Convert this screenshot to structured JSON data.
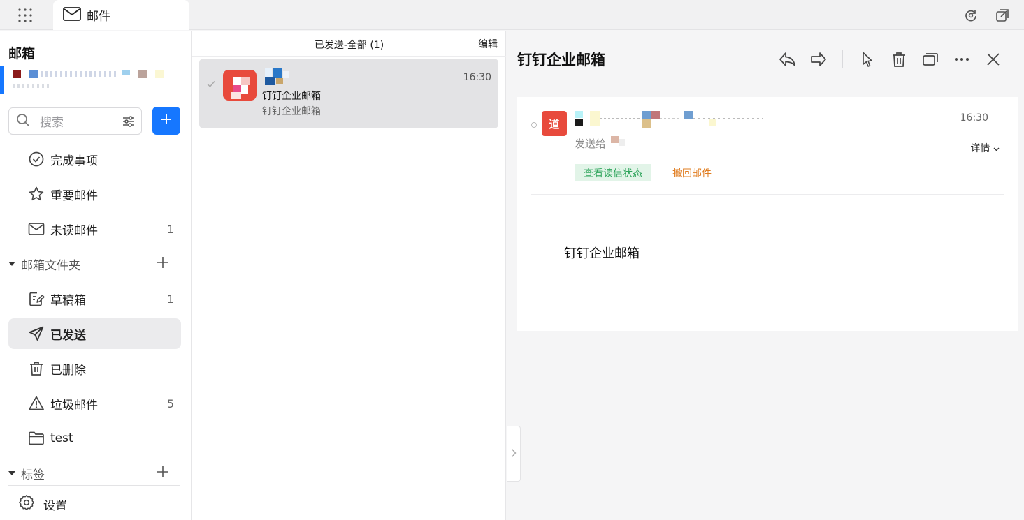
{
  "topbar": {
    "tab_label": "邮件",
    "tab_icon": "mail-icon",
    "right_icons": [
      "refresh-icon",
      "popout-window-icon"
    ]
  },
  "sidebar": {
    "title": "邮箱",
    "search_placeholder": "搜索",
    "quick_items": [
      {
        "label": "完成事项",
        "icon": "check-circle-icon",
        "count": ""
      },
      {
        "label": "重要邮件",
        "icon": "star-icon",
        "count": ""
      },
      {
        "label": "未读邮件",
        "icon": "mail-icon",
        "count": "1"
      }
    ],
    "folders_section": "邮箱文件夹",
    "folders": [
      {
        "label": "草稿箱",
        "icon": "draft-icon",
        "count": "1"
      },
      {
        "label": "已发送",
        "icon": "send-icon",
        "count": "",
        "active": true
      },
      {
        "label": "已删除",
        "icon": "trash-icon",
        "count": ""
      },
      {
        "label": "垃圾邮件",
        "icon": "warning-icon",
        "count": "5"
      },
      {
        "label": "test",
        "icon": "folder-icon",
        "count": ""
      }
    ],
    "tags_section": "标签",
    "settings_label": "设置"
  },
  "list": {
    "header_title": "已发送-全部 (1)",
    "edit_label": "编辑",
    "items": [
      {
        "subject": "钉钉企业邮箱",
        "preview": "钉钉企业邮箱",
        "time": "16:30"
      }
    ]
  },
  "reader": {
    "subject": "钉钉企业邮箱",
    "toolbar": [
      "reply-icon",
      "forward-icon",
      "mark-icon",
      "trash-icon",
      "new-window-icon",
      "more-icon",
      "close-icon"
    ],
    "avatar_text": "道",
    "to_label": "发送给",
    "time": "16:30",
    "detail_label": "详情",
    "read_status_label": "查看读信状态",
    "recall_label": "撤回邮件",
    "body": "钉钉企业邮箱"
  },
  "colors": {
    "accent": "#1677ff",
    "avatar_red": "#e84a3c",
    "green": "#2ea45b",
    "orange": "#e07c1f"
  }
}
